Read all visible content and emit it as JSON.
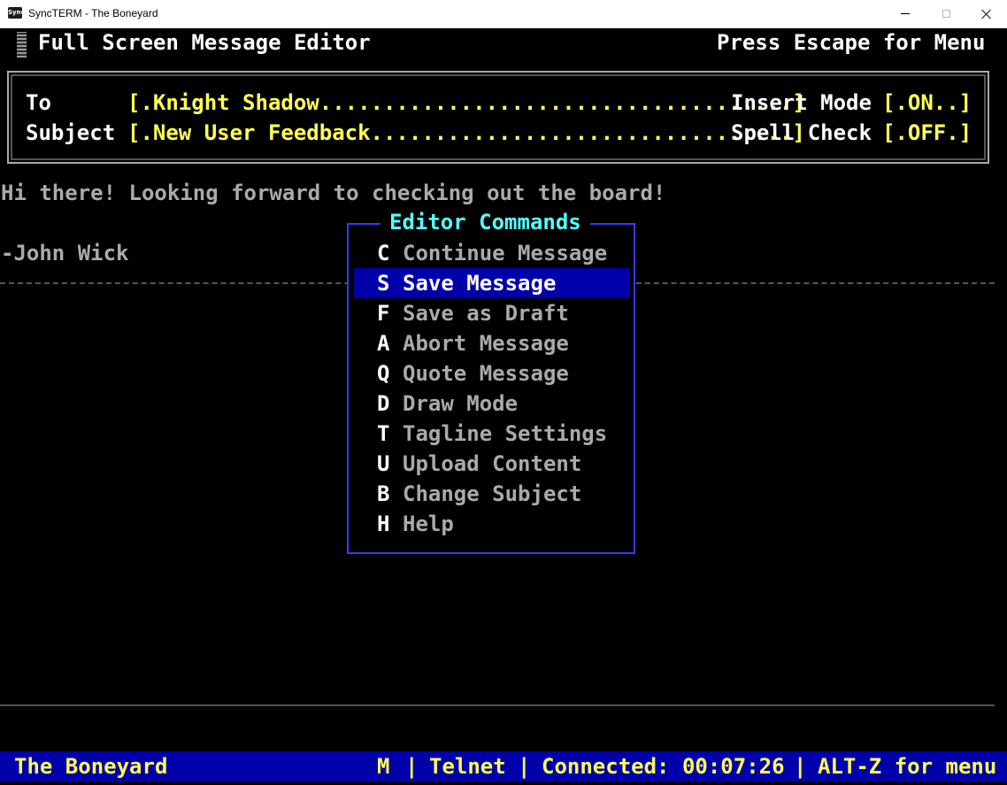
{
  "window": {
    "title": "SyncTERM - The Boneyard",
    "icon_label": "Sync"
  },
  "header": {
    "title": "Full Screen Message Editor",
    "hint": "Press Escape for Menu"
  },
  "fields": {
    "to_label": "To",
    "to_value": "[.Knight Shadow.....................................]",
    "subject_label": "Subject",
    "subject_value": "[.New User Feedback.................................]",
    "insert_label": "Insert Mode",
    "insert_value": "[.ON..]",
    "spell_label": "Spell Check",
    "spell_value": "[.OFF.]"
  },
  "body": {
    "line1": "Hi there! Looking forward to checking out the board!",
    "line2": "-John Wick"
  },
  "menu": {
    "title": "Editor Commands",
    "items": [
      {
        "key": "C",
        "label": "Continue Message"
      },
      {
        "key": "S",
        "label": "Save Message"
      },
      {
        "key": "F",
        "label": "Save as Draft"
      },
      {
        "key": "A",
        "label": "Abort Message"
      },
      {
        "key": "Q",
        "label": "Quote Message"
      },
      {
        "key": "D",
        "label": "Draw Mode"
      },
      {
        "key": "T",
        "label": "Tagline Settings"
      },
      {
        "key": "U",
        "label": "Upload Content"
      },
      {
        "key": "B",
        "label": "Change Subject"
      },
      {
        "key": "H",
        "label": "Help"
      }
    ],
    "selected": "S"
  },
  "status": {
    "bbs": "The Boneyard",
    "mode": "M",
    "protocol": "Telnet",
    "connected": "Connected: 00:07:26",
    "menu_hint": "ALT-Z for menu",
    "sep": "|"
  },
  "colors": {
    "background": "#000000",
    "status_bar": "#0000aa",
    "status_text": "#ffff55",
    "popup_border": "#3a3aff",
    "popup_title": "#55ffff",
    "selection": "#0000aa"
  }
}
